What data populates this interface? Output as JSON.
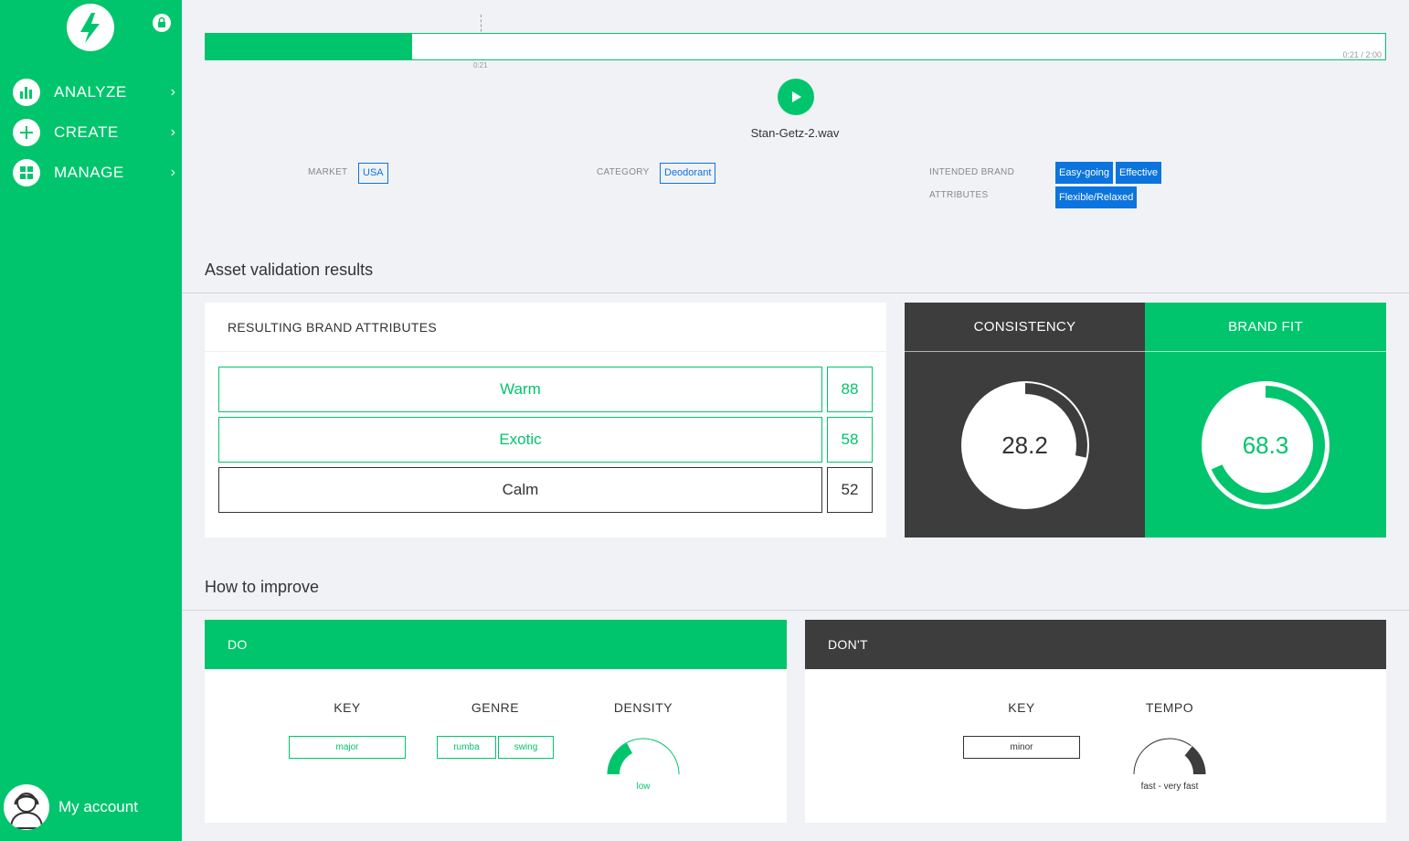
{
  "sidebar": {
    "nav": [
      {
        "label": "ANALYZE",
        "icon": "bar-chart-icon"
      },
      {
        "label": "CREATE",
        "icon": "plus-icon"
      },
      {
        "label": "MANAGE",
        "icon": "grid-icon"
      }
    ],
    "account_label": "My account"
  },
  "player": {
    "progress_fraction": 0.175,
    "time_display": "0:21 / 2:00",
    "cursor_time": "0:21",
    "file_name": "Stan-Getz-2.wav"
  },
  "meta": {
    "market_label": "MARKET",
    "market_value": "USA",
    "category_label": "CATEGORY",
    "category_value": "Deodorant",
    "intended_label_1": "INTENDED BRAND",
    "intended_label_2": "ATTRIBUTES",
    "intended_values": [
      "Easy-going",
      "Effective",
      "Flexible/Relaxed"
    ]
  },
  "results": {
    "section_title": "Asset validation results",
    "attributes_title": "RESULTING BRAND ATTRIBUTES",
    "attributes": [
      {
        "name": "Warm",
        "value": "88"
      },
      {
        "name": "Exotic",
        "value": "58"
      },
      {
        "name": "Calm",
        "value": "52"
      }
    ],
    "consistency": {
      "label": "CONSISTENCY",
      "value": "28.2"
    },
    "brand_fit": {
      "label": "BRAND FIT",
      "value": "68.3"
    }
  },
  "improve": {
    "section_title": "How to improve",
    "do": {
      "title": "DO",
      "key_title": "KEY",
      "key_values": [
        "major"
      ],
      "genre_title": "GENRE",
      "genre_values": [
        "rumba",
        "swing"
      ],
      "density_title": "DENSITY",
      "density_value": "low"
    },
    "dont": {
      "title": "DON'T",
      "key_title": "KEY",
      "key_values": [
        "minor"
      ],
      "tempo_title": "TEMPO",
      "tempo_value": "fast - very fast"
    }
  },
  "colors": {
    "brand_green": "#00c56c",
    "dark_panel": "#3d3d3d",
    "tag_blue": "#0b74de",
    "background": "#f1f2f6"
  }
}
